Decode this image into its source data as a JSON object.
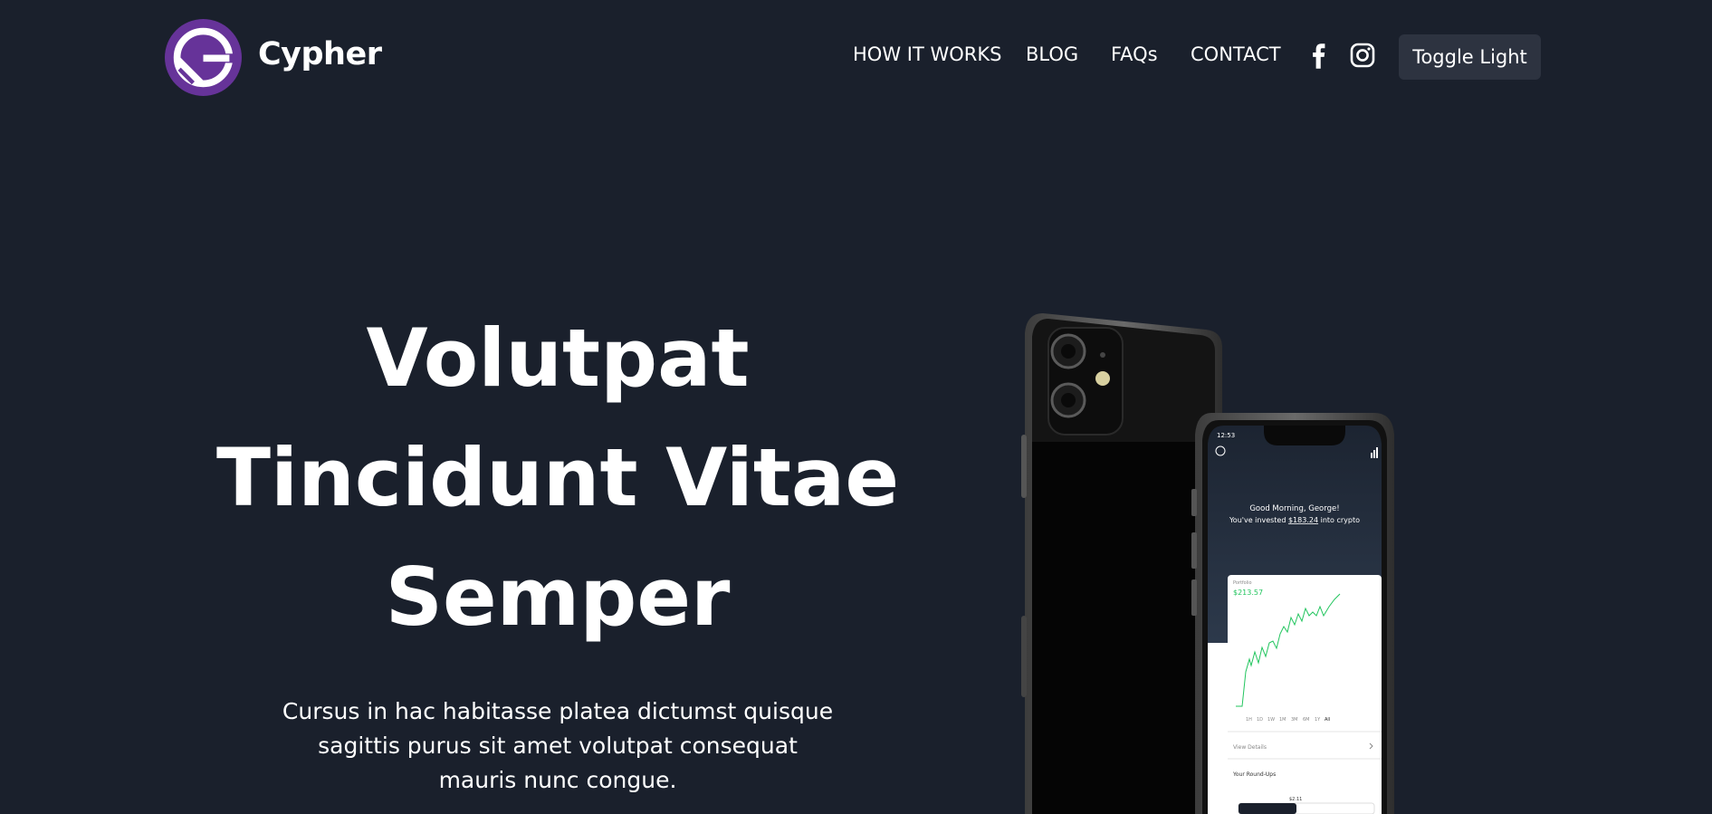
{
  "header": {
    "brand": "Cypher",
    "nav": [
      {
        "label": "HOW IT WORKS"
      },
      {
        "label": "BLOG"
      },
      {
        "label": "FAQs"
      },
      {
        "label": "CONTACT"
      }
    ],
    "social": [
      "facebook-icon",
      "instagram-icon"
    ],
    "toggle_label": "Toggle Light"
  },
  "hero": {
    "title_lines": [
      "Volutpat",
      "Tincidunt Vitae",
      "Semper"
    ],
    "subtitle": "Cursus in hac habitasse platea dictumst quisque sagittis purus sit amet volutpat consequat mauris nunc congue."
  },
  "phone_screen": {
    "time": "12:53",
    "greeting": "Good Morning, George!",
    "invested_prefix": "You've invested ",
    "invested_amount": "$183.24",
    "invested_suffix": " into crypto",
    "portfolio_label": "Portfolio",
    "portfolio_value": "$213.57",
    "ranges": [
      "1H",
      "1D",
      "1W",
      "1M",
      "3M",
      "6M",
      "1Y",
      "All"
    ],
    "view_details": "View Details",
    "round_ups": "Your Round-Ups",
    "round_up_value": "$2.11",
    "accent_green": "#22c55e"
  },
  "colors": {
    "background": "#1a202c",
    "button_bg": "#2d3340",
    "logo_purple": "#663399"
  }
}
